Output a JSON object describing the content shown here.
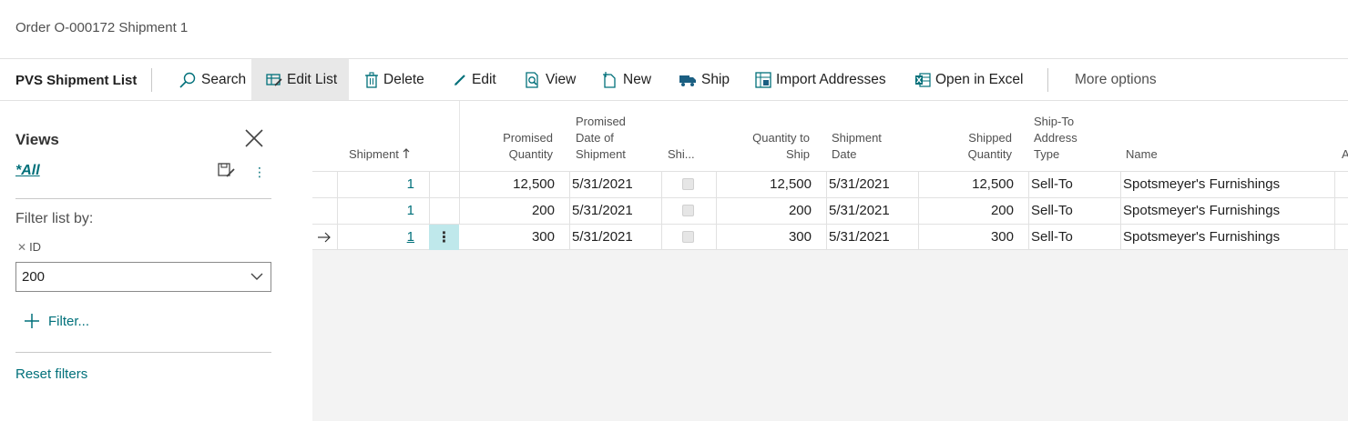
{
  "breadcrumb": "Order O-000172 Shipment 1",
  "toolbar": {
    "page_title": "PVS Shipment List",
    "search": "Search",
    "edit_list": "Edit List",
    "delete": "Delete",
    "edit": "Edit",
    "view": "View",
    "new": "New",
    "ship": "Ship",
    "import_addresses": "Import Addresses",
    "open_in_excel": "Open in Excel",
    "more_options": "More options"
  },
  "filter_pane": {
    "title": "Views",
    "current_view": "*All",
    "filter_list_by": "Filter list by:",
    "filter_field": "ID",
    "filter_value": "200",
    "add_filter": "Filter...",
    "reset_filters": "Reset filters"
  },
  "table": {
    "headers": {
      "shipment": "Shipment",
      "promised_quantity_1": "Promised",
      "promised_quantity_2": "Quantity",
      "promised_date_1": "Promised",
      "promised_date_2": "Date of",
      "promised_date_3": "Shipment",
      "shipped_flag": "Shi...",
      "qty_to_ship_1": "Quantity to",
      "qty_to_ship_2": "Ship",
      "shipment_date_1": "Shipment",
      "shipment_date_2": "Date",
      "shipped_qty_1": "Shipped",
      "shipped_qty_2": "Quantity",
      "address_type_1": "Ship-To",
      "address_type_2": "Address",
      "address_type_3": "Type",
      "name": "Name",
      "next_col": "A"
    },
    "rows": [
      {
        "shipment": "1",
        "promised_quantity": "12,500",
        "promised_date": "5/31/2021",
        "qty_to_ship": "12,500",
        "shipment_date": "5/31/2021",
        "shipped_qty": "12,500",
        "address_type": "Sell-To",
        "name": "Spotsmeyer's Furnishings"
      },
      {
        "shipment": "1",
        "promised_quantity": "200",
        "promised_date": "5/31/2021",
        "qty_to_ship": "200",
        "shipment_date": "5/31/2021",
        "shipped_qty": "200",
        "address_type": "Sell-To",
        "name": "Spotsmeyer's Furnishings"
      },
      {
        "shipment": "1",
        "promised_quantity": "300",
        "promised_date": "5/31/2021",
        "qty_to_ship": "300",
        "shipment_date": "5/31/2021",
        "shipped_qty": "300",
        "address_type": "Sell-To",
        "name": "Spotsmeyer's Furnishings"
      }
    ]
  },
  "colors": {
    "accent": "#00707a",
    "selected_cell": "#bfe8eb",
    "grid_background": "#f3f3f3"
  }
}
